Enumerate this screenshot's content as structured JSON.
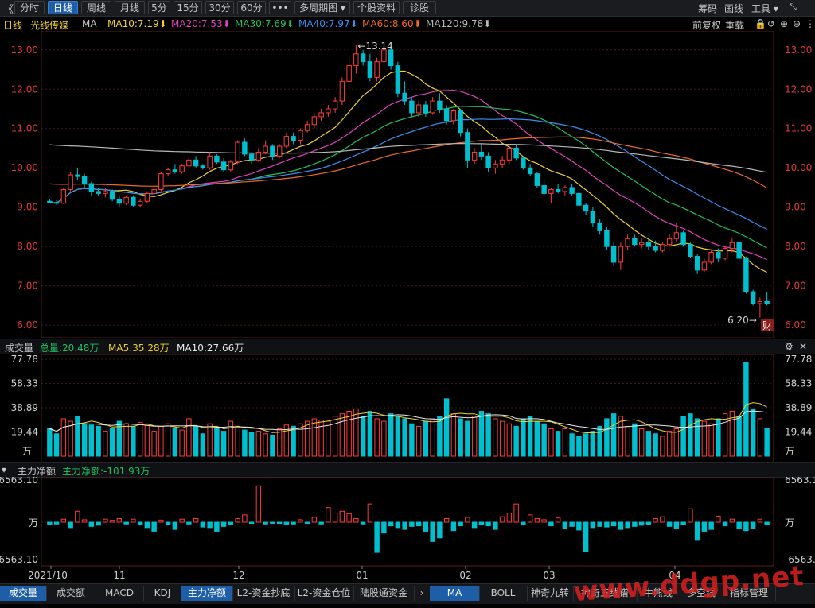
{
  "toolbar": {
    "back_glyph": "《",
    "tabs": [
      {
        "label": "分时"
      },
      {
        "label": "日线",
        "active": true
      },
      {
        "label": "周线"
      },
      {
        "label": "月线"
      },
      {
        "label": "5分"
      },
      {
        "label": "15分"
      },
      {
        "label": "30分"
      },
      {
        "label": "60分"
      },
      {
        "label": "•••"
      },
      {
        "label": "多周期图 ▾"
      },
      {
        "label": "个股资料"
      },
      {
        "label": "诊股"
      }
    ],
    "right_items": [
      "筹码",
      "画线",
      "工具 ▾"
    ]
  },
  "ma_bar": {
    "period": "日线",
    "stock_name": "光线传媒",
    "indicator": "MA",
    "items": [
      {
        "text": "MA10:7.19",
        "color": "#f0d22c"
      },
      {
        "text": "MA20:7.53",
        "color": "#e040c0"
      },
      {
        "text": "MA30:7.69",
        "color": "#20c060"
      },
      {
        "text": "MA40:7.97",
        "color": "#3a8ef0"
      },
      {
        "text": "MA60:8.60",
        "color": "#f06a28"
      },
      {
        "text": "MA120:9.78",
        "color": "#b8b8b8"
      }
    ],
    "right_items": [
      "前复权",
      "重载"
    ]
  },
  "volume_header": {
    "title": "成交量",
    "total": "总量:20.48万",
    "ma5": "MA5:35.28万",
    "ma10": "MA10:27.66万"
  },
  "flow_header": {
    "title": "主力净额",
    "value": "主力净额:-101.93万"
  },
  "bottom_tabs": [
    {
      "label": "成交量",
      "active": true
    },
    {
      "label": "成交额"
    },
    {
      "label": "MACD"
    },
    {
      "label": "KDJ"
    },
    {
      "label": "主力净额",
      "active": true
    },
    {
      "label": "L2-资金抄底"
    },
    {
      "label": "L2-资金仓位"
    },
    {
      "label": "陆股通资金"
    },
    {
      "label": "›"
    },
    {
      "label": "MA",
      "active": true
    },
    {
      "label": "BOLL"
    },
    {
      "label": "神奇九转"
    },
    {
      "label": "神奇五线谱"
    },
    {
      "label": "牛熊线"
    },
    {
      "label": "多空线"
    },
    {
      "label": "指标管理"
    }
  ],
  "watermark": "www.ddgp.net",
  "colors": {
    "up": "#ff3c3c",
    "down": "#00c0d0",
    "grid": "#3a1a1a",
    "axis": "#e03838"
  },
  "chart_data": [
    {
      "type": "candlestick",
      "ylim": [
        5.8,
        13.4
      ],
      "yticks": [
        "13.00",
        "12.00",
        "11.00",
        "10.00",
        "9.00",
        "8.00",
        "7.00",
        "6.00"
      ],
      "x_labels": [
        "2021/10",
        "11",
        "12",
        "01",
        "02",
        "03",
        "04"
      ],
      "annotations": {
        "high": "←13.14",
        "low": "6.20→",
        "badge": "财"
      },
      "series_ma": [
        {
          "name": "MA10",
          "color": "#f0d22c"
        },
        {
          "name": "MA20",
          "color": "#e040c0"
        },
        {
          "name": "MA30",
          "color": "#20c060"
        },
        {
          "name": "MA40",
          "color": "#3a8ef0"
        },
        {
          "name": "MA60",
          "color": "#f06a28"
        },
        {
          "name": "MA120",
          "color": "#b8b8b8"
        }
      ],
      "ohlc": [
        [
          9.15,
          9.2,
          9.1,
          9.12
        ],
        [
          9.12,
          9.18,
          9.05,
          9.1
        ],
        [
          9.1,
          9.5,
          9.08,
          9.45
        ],
        [
          9.45,
          9.9,
          9.4,
          9.82
        ],
        [
          9.82,
          10.0,
          9.7,
          9.78
        ],
        [
          9.78,
          9.85,
          9.5,
          9.6
        ],
        [
          9.6,
          9.65,
          9.3,
          9.4
        ],
        [
          9.4,
          9.5,
          9.3,
          9.35
        ],
        [
          9.35,
          9.5,
          9.25,
          9.4
        ],
        [
          9.4,
          9.45,
          9.15,
          9.2
        ],
        [
          9.2,
          9.3,
          9.0,
          9.1
        ],
        [
          9.1,
          9.3,
          9.05,
          9.25
        ],
        [
          9.25,
          9.3,
          9.0,
          9.05
        ],
        [
          9.05,
          9.2,
          9.0,
          9.15
        ],
        [
          9.15,
          9.4,
          9.1,
          9.35
        ],
        [
          9.35,
          9.5,
          9.3,
          9.45
        ],
        [
          9.45,
          9.9,
          9.4,
          9.85
        ],
        [
          9.85,
          10.0,
          9.8,
          9.95
        ],
        [
          9.95,
          10.1,
          9.85,
          9.9
        ],
        [
          9.9,
          10.1,
          9.85,
          10.05
        ],
        [
          10.05,
          10.3,
          10.0,
          10.2
        ],
        [
          10.2,
          10.3,
          10.0,
          10.05
        ],
        [
          10.05,
          10.1,
          9.95,
          10.0
        ],
        [
          10.0,
          10.4,
          9.95,
          10.3
        ],
        [
          10.3,
          10.35,
          10.1,
          10.15
        ],
        [
          10.15,
          10.25,
          9.9,
          9.95
        ],
        [
          9.95,
          10.2,
          9.9,
          10.15
        ],
        [
          10.15,
          10.7,
          10.1,
          10.65
        ],
        [
          10.65,
          10.75,
          10.3,
          10.35
        ],
        [
          10.35,
          10.4,
          10.1,
          10.2
        ],
        [
          10.2,
          10.5,
          10.15,
          10.4
        ],
        [
          10.4,
          10.7,
          10.35,
          10.55
        ],
        [
          10.55,
          10.6,
          10.2,
          10.3
        ],
        [
          10.3,
          10.6,
          10.25,
          10.55
        ],
        [
          10.55,
          10.9,
          10.5,
          10.8
        ],
        [
          10.8,
          10.9,
          10.6,
          10.7
        ],
        [
          10.7,
          11.0,
          10.6,
          10.95
        ],
        [
          10.95,
          11.2,
          10.9,
          11.1
        ],
        [
          11.1,
          11.4,
          11.0,
          11.3
        ],
        [
          11.3,
          11.5,
          11.2,
          11.4
        ],
        [
          11.4,
          11.6,
          11.3,
          11.5
        ],
        [
          11.5,
          11.8,
          11.4,
          11.7
        ],
        [
          11.7,
          12.3,
          11.6,
          12.2
        ],
        [
          12.2,
          12.8,
          12.0,
          12.6
        ],
        [
          12.6,
          13.14,
          12.4,
          12.9
        ],
        [
          12.9,
          13.0,
          12.6,
          12.7
        ],
        [
          12.7,
          12.9,
          12.2,
          12.3
        ],
        [
          12.3,
          12.8,
          12.2,
          12.7
        ],
        [
          12.7,
          13.1,
          12.6,
          13.0
        ],
        [
          13.0,
          13.1,
          12.5,
          12.6
        ],
        [
          12.6,
          12.7,
          11.8,
          11.9
        ],
        [
          11.9,
          12.2,
          11.6,
          11.7
        ],
        [
          11.7,
          11.8,
          11.3,
          11.4
        ],
        [
          11.4,
          11.7,
          11.3,
          11.6
        ],
        [
          11.6,
          11.7,
          11.3,
          11.4
        ],
        [
          11.4,
          11.8,
          11.35,
          11.7
        ],
        [
          11.7,
          11.9,
          11.4,
          11.5
        ],
        [
          11.5,
          11.6,
          11.1,
          11.2
        ],
        [
          11.2,
          11.5,
          11.1,
          11.45
        ],
        [
          11.45,
          11.5,
          10.8,
          10.9
        ],
        [
          10.9,
          11.0,
          10.0,
          10.2
        ],
        [
          10.2,
          10.5,
          10.1,
          10.4
        ],
        [
          10.4,
          10.6,
          10.2,
          10.3
        ],
        [
          10.3,
          10.4,
          9.9,
          10.0
        ],
        [
          10.0,
          10.2,
          9.85,
          10.1
        ],
        [
          10.1,
          10.3,
          10.0,
          10.2
        ],
        [
          10.2,
          10.6,
          10.1,
          10.5
        ],
        [
          10.5,
          10.6,
          10.2,
          10.25
        ],
        [
          10.25,
          10.3,
          9.95,
          10.0
        ],
        [
          10.0,
          10.1,
          9.8,
          9.85
        ],
        [
          9.85,
          9.9,
          9.5,
          9.55
        ],
        [
          9.55,
          9.7,
          9.3,
          9.35
        ],
        [
          9.35,
          9.5,
          9.1,
          9.45
        ],
        [
          9.45,
          9.6,
          9.35,
          9.4
        ],
        [
          9.4,
          9.55,
          9.3,
          9.5
        ],
        [
          9.5,
          9.6,
          9.3,
          9.35
        ],
        [
          9.35,
          9.4,
          9.0,
          9.05
        ],
        [
          9.05,
          9.1,
          8.8,
          8.9
        ],
        [
          8.9,
          9.0,
          8.5,
          8.6
        ],
        [
          8.6,
          8.7,
          8.3,
          8.4
        ],
        [
          8.4,
          8.5,
          7.9,
          8.0
        ],
        [
          8.0,
          8.1,
          7.5,
          7.6
        ],
        [
          7.6,
          8.1,
          7.4,
          8.0
        ],
        [
          8.0,
          8.3,
          7.9,
          8.2
        ],
        [
          8.2,
          8.3,
          8.0,
          8.05
        ],
        [
          8.05,
          8.2,
          7.95,
          8.1
        ],
        [
          8.1,
          8.2,
          7.9,
          8.0
        ],
        [
          8.0,
          8.15,
          7.85,
          7.9
        ],
        [
          7.9,
          8.1,
          7.85,
          8.05
        ],
        [
          8.05,
          8.3,
          8.0,
          8.2
        ],
        [
          8.2,
          8.6,
          8.1,
          8.35
        ],
        [
          8.35,
          8.4,
          8.0,
          8.05
        ],
        [
          8.05,
          8.1,
          7.7,
          7.75
        ],
        [
          7.75,
          7.8,
          7.3,
          7.4
        ],
        [
          7.4,
          7.7,
          7.35,
          7.6
        ],
        [
          7.6,
          7.9,
          7.55,
          7.85
        ],
        [
          7.85,
          7.95,
          7.6,
          7.7
        ],
        [
          7.7,
          8.0,
          7.65,
          7.95
        ],
        [
          7.95,
          8.2,
          7.85,
          8.1
        ],
        [
          8.1,
          8.15,
          7.6,
          7.7
        ],
        [
          7.7,
          7.75,
          6.8,
          6.85
        ],
        [
          6.85,
          6.9,
          6.5,
          6.55
        ],
        [
          6.55,
          6.7,
          6.2,
          6.6
        ],
        [
          6.6,
          6.85,
          6.5,
          6.55
        ]
      ]
    },
    {
      "type": "bar",
      "name": "成交量",
      "unit": "万",
      "ylim": [
        0,
        77.78
      ],
      "yticks": [
        "77.78",
        "58.33",
        "38.89",
        "19.44"
      ],
      "values": [
        22,
        18,
        30,
        28,
        32,
        26,
        25,
        24,
        20,
        22,
        28,
        26,
        24,
        27,
        25,
        20,
        24,
        26,
        22,
        21,
        30,
        24,
        18,
        26,
        22,
        20,
        28,
        24,
        21,
        19,
        20,
        18,
        17,
        22,
        25,
        24,
        26,
        28,
        30,
        29,
        28,
        32,
        34,
        36,
        38,
        32,
        36,
        30,
        28,
        34,
        32,
        30,
        26,
        24,
        28,
        30,
        32,
        46,
        34,
        30,
        28,
        32,
        36,
        34,
        30,
        28,
        26,
        24,
        30,
        32,
        28,
        26,
        22,
        20,
        22,
        18,
        16,
        18,
        20,
        24,
        30,
        34,
        32,
        24,
        26,
        22,
        20,
        18,
        16,
        20,
        22,
        32,
        34,
        30,
        28,
        26,
        30,
        34,
        36,
        32,
        75,
        38,
        30,
        22
      ]
    },
    {
      "type": "bar",
      "name": "主力净额",
      "unit": "万",
      "ylim": [
        -6563.1,
        6563.1
      ],
      "yticks": [
        "6563.10",
        "万",
        "-6563.10"
      ],
      "values": [
        -400,
        -300,
        500,
        -900,
        1800,
        400,
        -700,
        -500,
        500,
        300,
        600,
        -300,
        500,
        -400,
        -900,
        -1500,
        300,
        -400,
        -1200,
        500,
        -300,
        600,
        -800,
        -900,
        -1500,
        -700,
        -400,
        600,
        1200,
        -200,
        6000,
        -300,
        -200,
        -200,
        -400,
        -300,
        400,
        -200,
        800,
        -300,
        2400,
        1500,
        1800,
        1400,
        600,
        -300,
        3000,
        -5000,
        -1800,
        -600,
        -900,
        -1200,
        -700,
        -600,
        -1500,
        -3200,
        -2600,
        600,
        -1400,
        -600,
        800,
        -900,
        -400,
        -600,
        -1200,
        900,
        1500,
        3000,
        -400,
        1200,
        600,
        400,
        -600,
        700,
        -1000,
        -700,
        -1300,
        -4900,
        -900,
        -700,
        -800,
        -600,
        -1200,
        -900,
        -700,
        -500,
        -400,
        600,
        900,
        -700,
        -1000,
        -400,
        2200,
        -3000,
        -1500,
        -1200,
        1000,
        -600,
        500,
        -1100,
        -1400,
        -1000,
        500,
        -400
      ]
    }
  ]
}
